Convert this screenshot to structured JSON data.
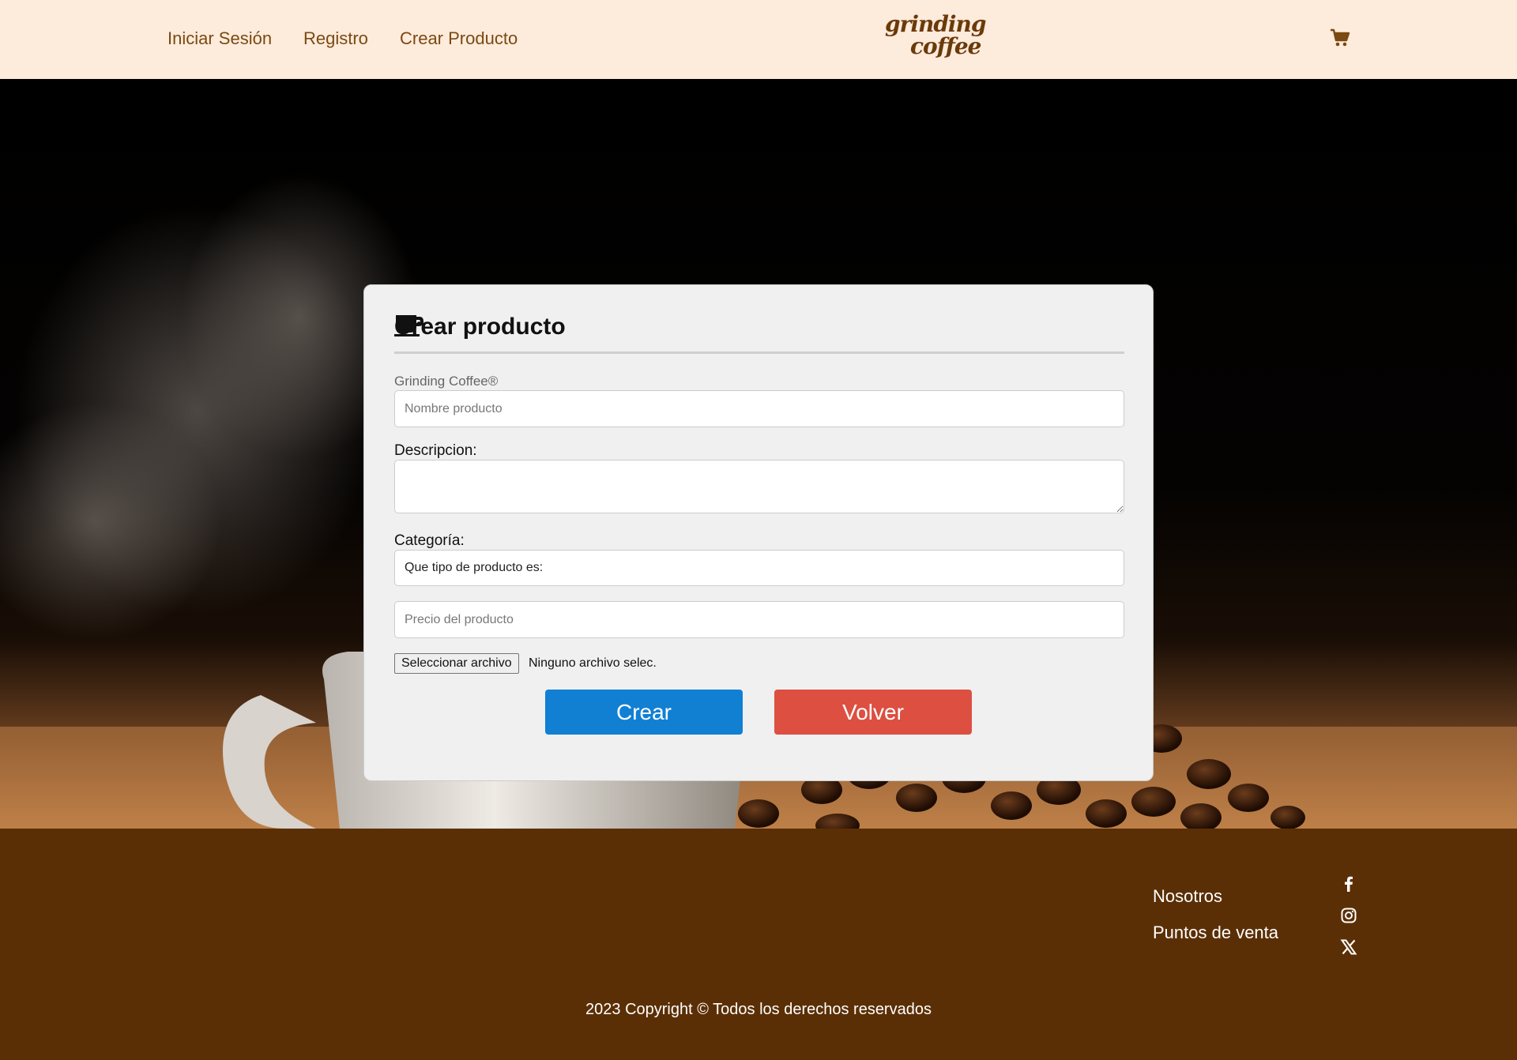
{
  "nav": {
    "login": "Iniciar Sesión",
    "register": "Registro",
    "create_product": "Crear Producto",
    "logo_line1": "grinding",
    "logo_line2": "coffee",
    "cart_icon": "cart-icon"
  },
  "form": {
    "title": "Crear producto",
    "title_icon": "coffee-cup-icon",
    "brand_label": "Grinding Coffee®",
    "name_placeholder": "Nombre producto",
    "description_label": "Descripcion:",
    "description_value": "",
    "category_label": "Categoría:",
    "category_selected": "Que tipo de producto es:",
    "price_placeholder": "Precio del producto",
    "file_button": "Seleccionar archivo",
    "file_status": "Ninguno archivo selec.",
    "create_button": "Crear",
    "back_button": "Volver"
  },
  "footer": {
    "about": "Nosotros",
    "stores": "Puntos de venta",
    "social": [
      "facebook-icon",
      "instagram-icon",
      "x-icon"
    ],
    "copyright": "2023 Copyright © Todos los derechos reservados"
  },
  "colors": {
    "nav_bg": "#fdebdc",
    "nav_text": "#7a4a12",
    "footer_bg": "#5b2f05",
    "create_button": "#1180d3",
    "back_button": "#dc4f41",
    "card_bg": "#f0f0f0"
  }
}
